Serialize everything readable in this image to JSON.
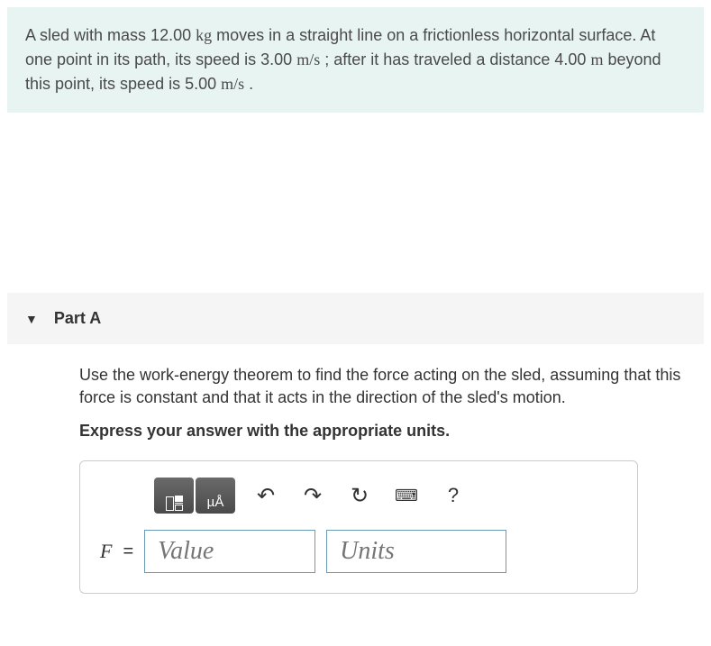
{
  "problem": {
    "text_parts": [
      "A sled with mass 12.00",
      "kg",
      " moves in a straight line on a frictionless horizontal surface. At one point in its path, its speed is 3.00",
      "m/s",
      "; after it has traveled a distance 4.00",
      "m",
      " beyond this point, its speed is 5.00",
      "m/s",
      "."
    ]
  },
  "part": {
    "label": "Part A",
    "question": "Use the work-energy theorem to find the force acting on the sled, assuming that this force is constant and that it acts in the direction of the sled's motion.",
    "instruction": "Express your answer with the appropriate units.",
    "variable": "F",
    "equals": "=",
    "value_placeholder": "Value",
    "units_placeholder": "Units",
    "toolbar": {
      "special_char": "µÅ",
      "undo": "↶",
      "redo": "↷",
      "reset": "↻",
      "keyboard": "⌨",
      "help": "?"
    }
  }
}
